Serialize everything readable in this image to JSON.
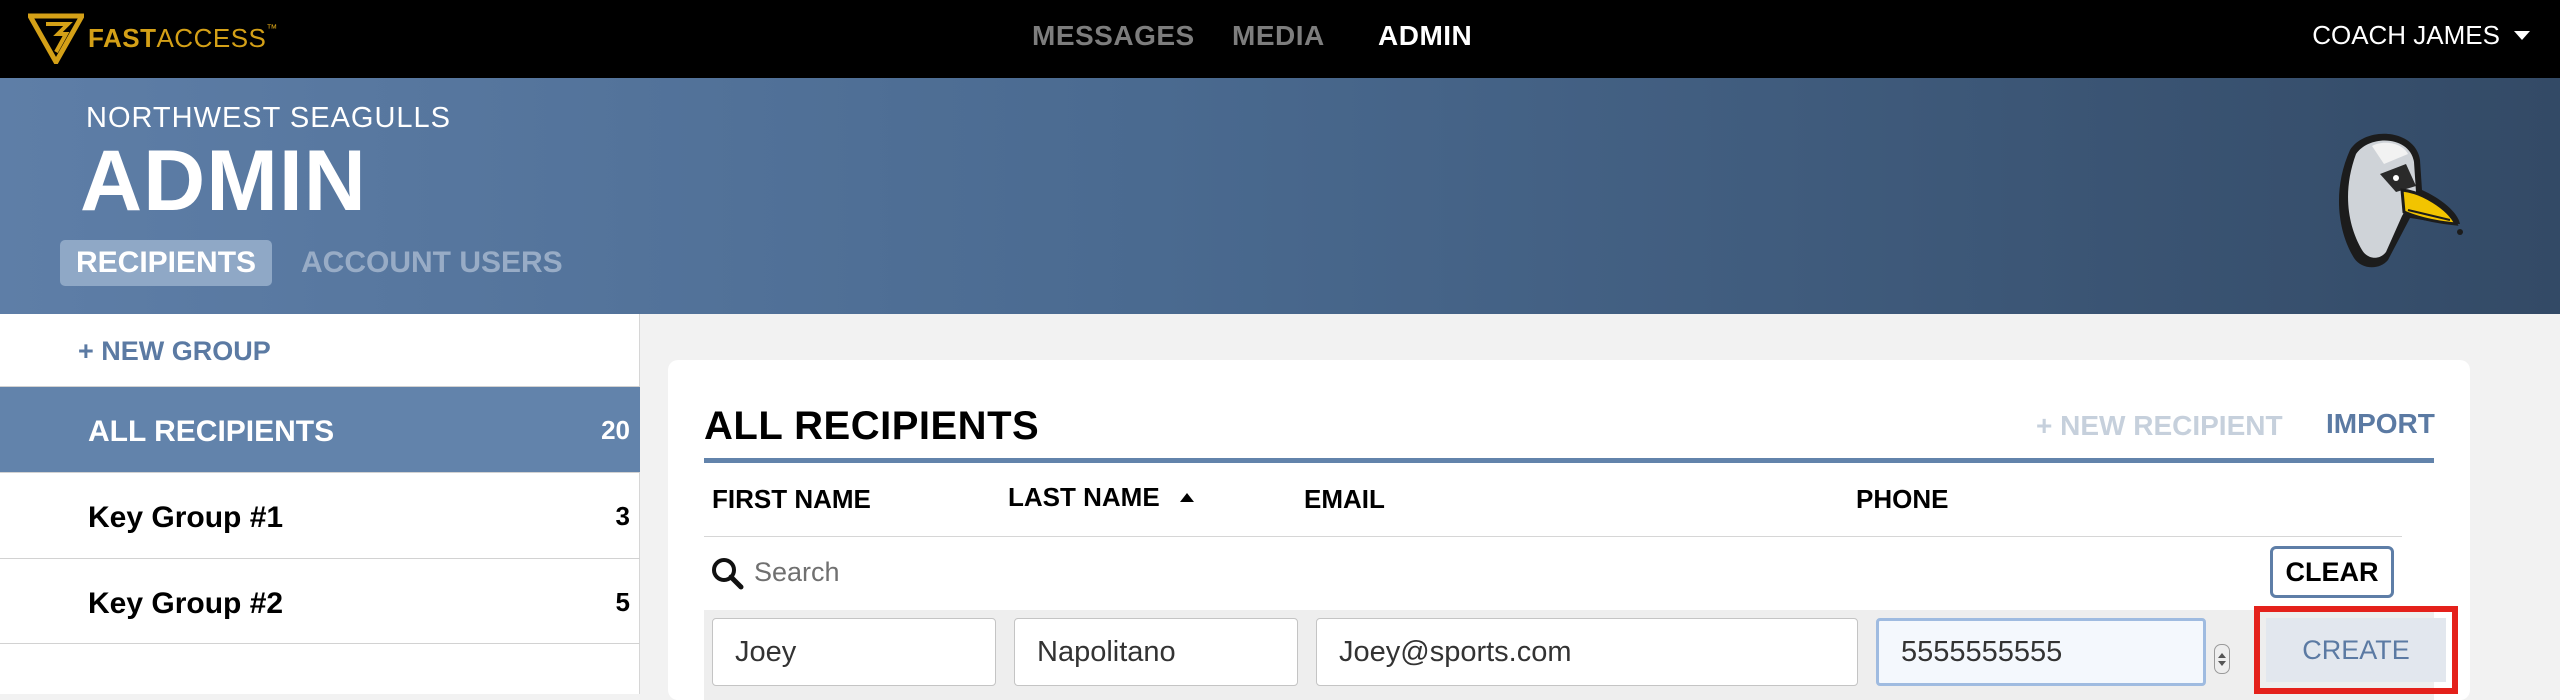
{
  "brand": {
    "bold": "FAST",
    "thin": "ACCESS",
    "tm": "™"
  },
  "nav": {
    "messages": "MESSAGES",
    "media": "MEDIA",
    "admin": "ADMIN"
  },
  "user": {
    "name": "COACH JAMES"
  },
  "header": {
    "org": "NORTHWEST SEAGULLS",
    "title": "ADMIN",
    "tabs": [
      "RECIPIENTS",
      "ACCOUNT USERS"
    ]
  },
  "sidebar": {
    "new_group": "+ NEW GROUP",
    "groups": [
      {
        "name": "ALL RECIPIENTS",
        "count": "20"
      },
      {
        "name": "Key Group #1",
        "count": "3"
      },
      {
        "name": "Key Group #2",
        "count": "5"
      }
    ]
  },
  "main": {
    "title": "ALL RECIPIENTS",
    "new_recipient": "+ NEW RECIPIENT",
    "import": "IMPORT",
    "columns": [
      "FIRST NAME",
      "LAST NAME",
      "EMAIL",
      "PHONE"
    ],
    "search_placeholder": "Search",
    "clear": "CLEAR",
    "new_row": {
      "first": "Joey",
      "last": "Napolitano",
      "email": "Joey@sports.com",
      "phone": "5555555555",
      "create": "CREATE"
    }
  },
  "colors": {
    "accent": "#5b7aa3",
    "active_row": "#6283ab",
    "logo_gold": "#d4a017",
    "highlight": "#e4211b"
  }
}
